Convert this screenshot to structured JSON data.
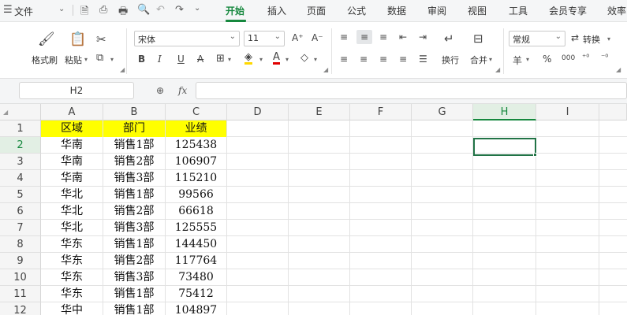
{
  "menubar": {
    "file_label": "文件",
    "tabs": [
      {
        "label": "开始",
        "active": true
      },
      {
        "label": "插入"
      },
      {
        "label": "页面"
      },
      {
        "label": "公式"
      },
      {
        "label": "数据"
      },
      {
        "label": "审阅"
      },
      {
        "label": "视图"
      },
      {
        "label": "工具"
      },
      {
        "label": "会员专享"
      },
      {
        "label": "效率"
      }
    ],
    "accent_color": "#16883e"
  },
  "ribbon": {
    "format_painter": "格式刷",
    "paste": "粘贴",
    "font_name": "宋体",
    "font_size": "11",
    "font_grow": "A⁺",
    "font_shrink": "A⁻",
    "bold": "B",
    "italic": "I",
    "underline": "U",
    "strike": "A",
    "wrap": "换行",
    "merge": "合并",
    "number_format": "常规",
    "convert": "转换",
    "currency": "羊",
    "percent": "%",
    "thousands": "000"
  },
  "formula_bar": {
    "name_box": "H2",
    "fx_label": "fx",
    "value": ""
  },
  "grid": {
    "columns": [
      "A",
      "B",
      "C",
      "D",
      "E",
      "F",
      "G",
      "H",
      "I"
    ],
    "selected_column": "H",
    "selected_row": "2",
    "rows": [
      {
        "num": "1",
        "cells": [
          "区域",
          "部门",
          "业绩"
        ]
      },
      {
        "num": "2",
        "cells": [
          "华南",
          "销售1部",
          "125438"
        ]
      },
      {
        "num": "3",
        "cells": [
          "华南",
          "销售2部",
          "106907"
        ]
      },
      {
        "num": "4",
        "cells": [
          "华南",
          "销售3部",
          "115210"
        ]
      },
      {
        "num": "5",
        "cells": [
          "华北",
          "销售1部",
          "99566"
        ]
      },
      {
        "num": "6",
        "cells": [
          "华北",
          "销售2部",
          "66618"
        ]
      },
      {
        "num": "7",
        "cells": [
          "华北",
          "销售3部",
          "125555"
        ]
      },
      {
        "num": "8",
        "cells": [
          "华东",
          "销售1部",
          "144450"
        ]
      },
      {
        "num": "9",
        "cells": [
          "华东",
          "销售2部",
          "117764"
        ]
      },
      {
        "num": "10",
        "cells": [
          "华东",
          "销售3部",
          "73480"
        ]
      },
      {
        "num": "11",
        "cells": [
          "华东",
          "销售1部",
          "75412"
        ]
      },
      {
        "num": "12",
        "cells": [
          "华中",
          "销售1部",
          "104897"
        ]
      }
    ],
    "header_fill": "#ffff00"
  }
}
